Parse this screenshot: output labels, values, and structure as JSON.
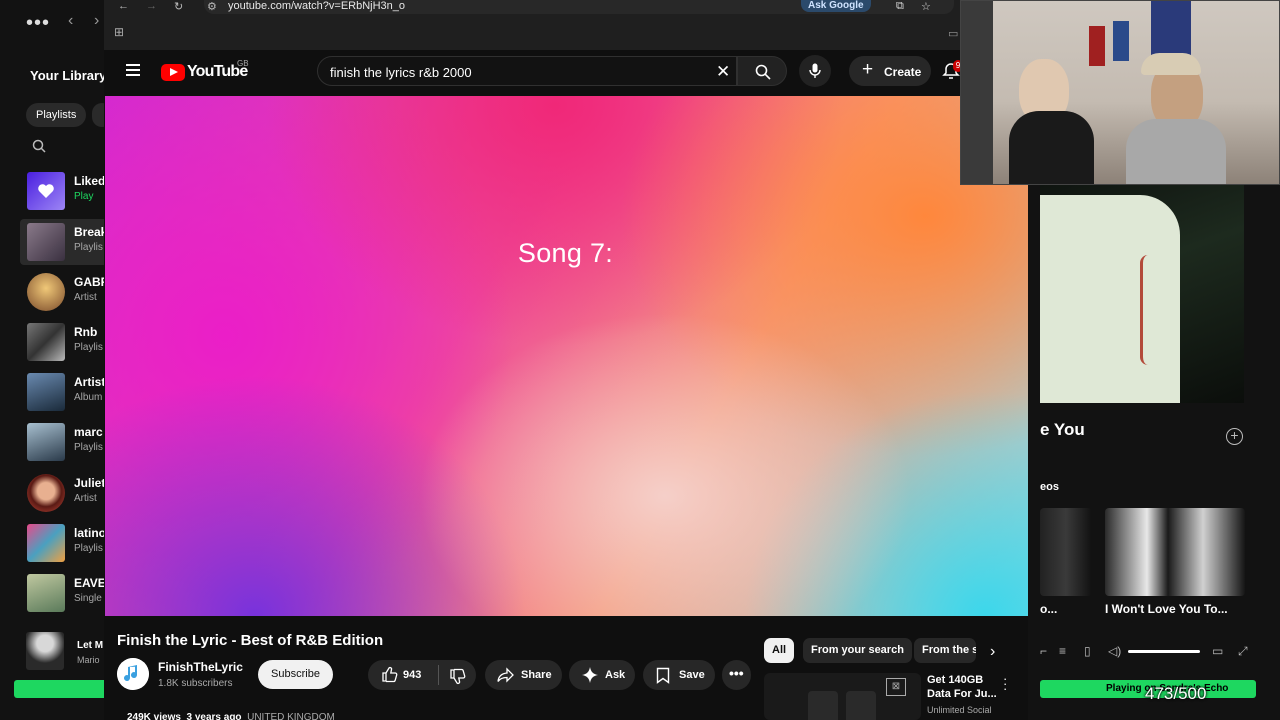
{
  "browser": {
    "url": "youtube.com/watch?v=ERbNjH3n_o",
    "ask_google": "Ask Google"
  },
  "spotify_left": {
    "library_title": "Your Library",
    "filter_chip": "Playlists",
    "items": [
      {
        "name": "Liked",
        "sub": "Play",
        "thumb_color": "#6c3cf5"
      },
      {
        "name": "Break",
        "sub": "Playlis",
        "thumb_color": "#6b5a6a"
      },
      {
        "name": "GABR",
        "sub": "Artist",
        "thumb_color": "#b08a5a"
      },
      {
        "name": "Rnb",
        "sub": "Playlis",
        "thumb_color": "#555555"
      },
      {
        "name": "Artist",
        "sub": "Album",
        "thumb_color": "#2e4a6a"
      },
      {
        "name": "marc",
        "sub": "Playlis",
        "thumb_color": "#4a6a7a"
      },
      {
        "name": "Juliet",
        "sub": "Artist",
        "thumb_color": "#c0483a"
      },
      {
        "name": "latino",
        "sub": "Playlis",
        "thumb_color": "#c43a7a"
      },
      {
        "name": "EAVE",
        "sub": "Single",
        "thumb_color": "#7a9a6a"
      }
    ],
    "now_playing_title": "Let M",
    "now_playing_artist": "Mario"
  },
  "spotify_right": {
    "title_fragment": "e You",
    "videos_label": "eos",
    "video_left_label": "o...",
    "video_right_label": "I Won't Love You To...",
    "green_bar_text": "Playing on Sandra's Echo"
  },
  "counter": "473/500",
  "youtube": {
    "logo_text": "YouTube",
    "country": "GB",
    "search_query": "finish the lyrics r&b 2000",
    "create_label": "Create",
    "notification_count": "9",
    "video_overlay_text": "Song 7:",
    "video_title": "Finish the Lyric - Best of R&B Edition",
    "channel_name": "FinishTheLyric",
    "channel_subs": "1.8K subscribers",
    "subscribe_label": "Subscribe",
    "likes": "943",
    "share_label": "Share",
    "ask_label": "Ask",
    "save_label": "Save",
    "views_text": "249K views",
    "age_text": "3 years ago",
    "location_text": "UNITED KINGDOM",
    "chips": [
      "All",
      "From your search",
      "From the s"
    ],
    "ad_title": "Get 140GB Data For Ju...",
    "ad_sub": "Unlimited Social"
  },
  "colors": {
    "spotify_green": "#1ed760",
    "youtube_red": "#ff0000",
    "background": "#0f0f0f"
  }
}
